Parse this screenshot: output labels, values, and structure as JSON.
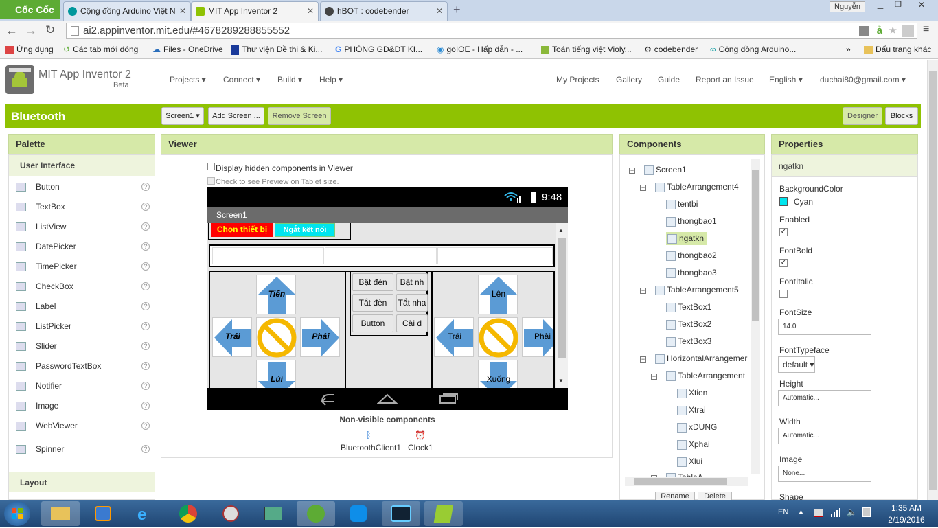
{
  "browser": {
    "brand": "Cốc Cốc",
    "tabs": [
      {
        "label": "Cộng đồng Arduino Việt N"
      },
      {
        "label": "MIT App Inventor 2"
      },
      {
        "label": "hBOT : codebender"
      }
    ],
    "url": "ai2.appinventor.mit.edu/#4678289288855552",
    "user": "Nguyễn",
    "bookmarks": [
      "Ứng dụng",
      "Các tab mới đóng",
      "Files - OneDrive",
      "Thư viện Đề thi & Ki...",
      "PHÒNG GD&ĐT KI...",
      "goIOE - Hấp dẫn - ...",
      "Toán tiếng việt Violy...",
      "codebender",
      "Cộng đồng Arduino..."
    ],
    "bookmarks_more": "»",
    "other_bookmarks": "Dấu trang khác"
  },
  "app": {
    "title": "MIT App Inventor 2",
    "beta": "Beta",
    "menus": [
      "Projects ▾",
      "Connect ▾",
      "Build ▾",
      "Help ▾"
    ],
    "right_menus": [
      "My Projects",
      "Gallery",
      "Guide",
      "Report an Issue",
      "English ▾",
      "duchai80@gmail.com ▾"
    ]
  },
  "project": {
    "name": "Bluetooth",
    "screen_select": "Screen1 ▾",
    "add_screen": "Add Screen ...",
    "remove_screen": "Remove Screen",
    "designer": "Designer",
    "blocks": "Blocks"
  },
  "palette": {
    "title": "Palette",
    "section": "User Interface",
    "items": [
      "Button",
      "TextBox",
      "ListView",
      "DatePicker",
      "TimePicker",
      "CheckBox",
      "Label",
      "ListPicker",
      "Slider",
      "PasswordTextBox",
      "Notifier",
      "Image",
      "WebViewer",
      "Spinner"
    ],
    "help": "?",
    "layout": "Layout"
  },
  "viewer": {
    "title": "Viewer",
    "hidden_label": "Display hidden components in Viewer",
    "tablet_label": "Check to see Preview on Tablet size.",
    "time": "9:48",
    "screen_title": "Screen1",
    "btn_select": "Chọn thiết bị",
    "btn_disconnect": "Ngắt kết nối",
    "left_pad": {
      "up": "Tiến",
      "left": "Trái",
      "right": "Phải",
      "down": "Lùi"
    },
    "right_pad": {
      "up": "Lên",
      "left": "Trái",
      "right": "Phải",
      "down": "Xuống"
    },
    "mid_buttons": [
      "Bật đèn",
      "Bật nh",
      "Tắt đèn",
      "Tắt nha",
      "Button",
      "Cài đ"
    ],
    "nonvisible_title": "Non-visible components",
    "nonvisible": [
      "BluetoothClient1",
      "Clock1"
    ]
  },
  "components": {
    "title": "Components",
    "tree": [
      "Screen1",
      "TableArrangement4",
      "tentbi",
      "thongbao1",
      "ngatkn",
      "thongbao2",
      "thongbao3",
      "TableArrangement5",
      "TextBox1",
      "TextBox2",
      "TextBox3",
      "HorizontalArrangemer",
      "TableArrangement",
      "Xtien",
      "Xtrai",
      "xDUNG",
      "Xphai",
      "Xlui",
      "TableA..."
    ],
    "rename": "Rename",
    "delete": "Delete"
  },
  "properties": {
    "title": "Properties",
    "component": "ngatkn",
    "bgcolor_label": "BackgroundColor",
    "bgcolor_value": "Cyan",
    "enabled_label": "Enabled",
    "fontbold_label": "FontBold",
    "fontitalic_label": "FontItalic",
    "fontsize_label": "FontSize",
    "fontsize_value": "14.0",
    "typeface_label": "FontTypeface",
    "typeface_value": "default ▾",
    "height_label": "Height",
    "height_value": "Automatic...",
    "width_label": "Width",
    "width_value": "Automatic...",
    "image_label": "Image",
    "image_value": "None...",
    "shape_label": "Shape",
    "enabled": true,
    "fontbold": true,
    "fontitalic": false
  },
  "taskbar": {
    "lang": "EN",
    "time": "1:35 AM",
    "date": "2/19/2016"
  },
  "colors": {
    "green": "#8fc202",
    "panel": "#d6e9a8",
    "cyan": "#00e5ee",
    "arrow": "#5b9bd5",
    "stop": "#f5b800"
  }
}
